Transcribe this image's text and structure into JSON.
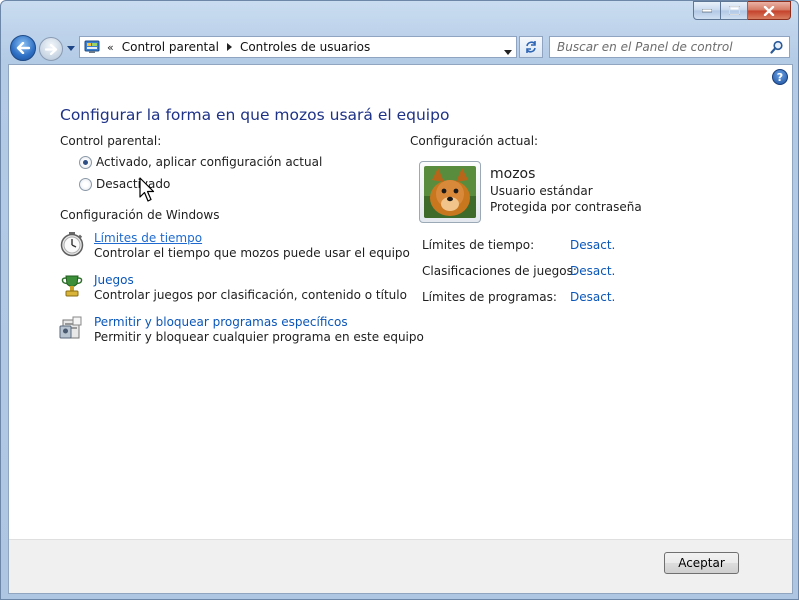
{
  "window": {
    "caption": {
      "minimize_icon": "minimize-icon",
      "maximize_icon": "maximize-icon",
      "close_icon": "close-icon"
    }
  },
  "nav": {
    "breadcrumbs": [
      "Control parental",
      "Controles de usuarios"
    ],
    "overflow_chevron": "«",
    "search_placeholder": "Buscar en el Panel de control"
  },
  "page": {
    "help_label": "?",
    "title": "Configurar la forma en que mozos usará el equipo",
    "parental_control": {
      "label": "Control parental:",
      "options": [
        {
          "label": "Activado, aplicar configuración actual",
          "checked": true
        },
        {
          "label": "Desactivado",
          "checked": false
        }
      ]
    },
    "windows_settings": {
      "label": "Configuración de Windows",
      "tasks": [
        {
          "link": "Límites de tiempo",
          "desc": "Controlar el tiempo que mozos puede usar el equipo",
          "icon": "stopwatch-icon"
        },
        {
          "link": "Juegos",
          "desc": "Controlar juegos por clasificación, contenido o título",
          "icon": "trophy-icon"
        },
        {
          "link": "Permitir y bloquear programas específicos",
          "desc": "Permitir y bloquear cualquier programa en este equipo",
          "icon": "program-block-icon"
        }
      ]
    },
    "current": {
      "label": "Configuración actual:",
      "user": {
        "name": "mozos",
        "role": "Usuario estándar",
        "protection": "Protegida por contraseña"
      },
      "settings": [
        {
          "label": "Límites de tiempo:",
          "value": "Desact."
        },
        {
          "label": "Clasificaciones de juegos:",
          "value": "Desact."
        },
        {
          "label": "Límites de programas:",
          "value": "Desact."
        }
      ]
    }
  },
  "footer": {
    "ok_label": "Aceptar"
  }
}
